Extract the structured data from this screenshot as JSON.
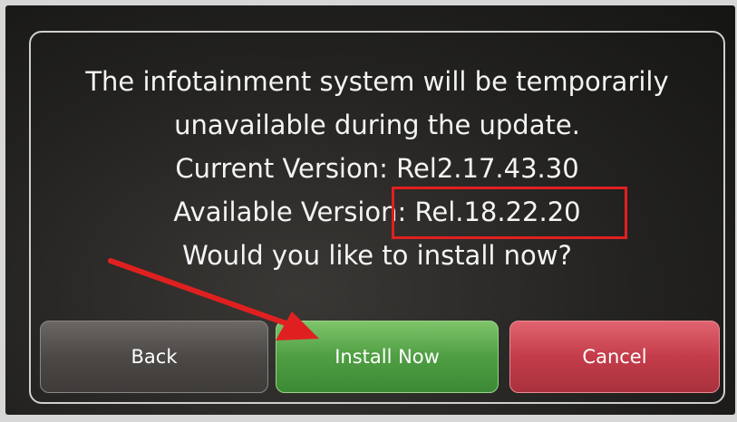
{
  "dialog": {
    "message_lines": [
      "The infotainment system will be temporarily",
      "unavailable during the update.",
      "Current Version: Rel2.17.43.30",
      "Available Version: Rel.18.22.20",
      "Would you like to install now?"
    ]
  },
  "buttons": {
    "back": "Back",
    "install_now": "Install Now",
    "cancel": "Cancel"
  },
  "colors": {
    "install_button": "#4f9e43",
    "cancel_button": "#c43c4a",
    "back_button": "#4b4846",
    "annotation": "#e02020"
  }
}
